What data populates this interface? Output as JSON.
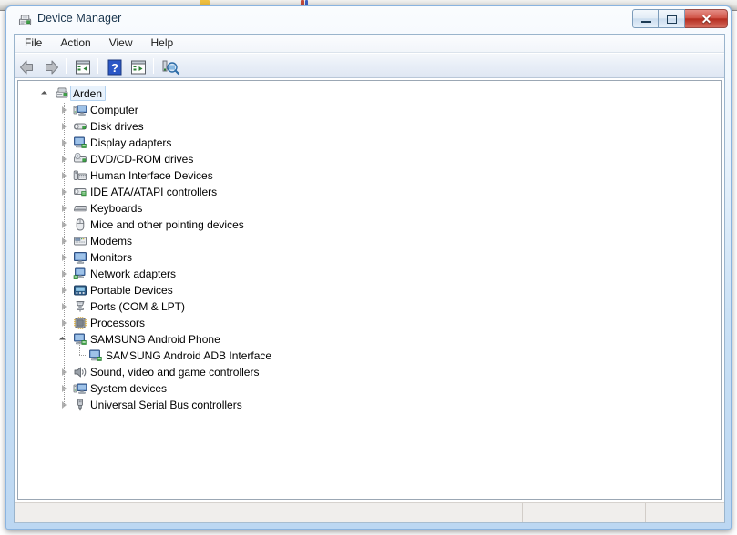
{
  "window": {
    "title": "Device Manager",
    "icon": "device-manager-icon",
    "controls": {
      "minimize": "Minimize",
      "maximize": "Maximize",
      "close": "Close",
      "close_glyph": "✕"
    }
  },
  "menubar": {
    "items": [
      {
        "label": "File",
        "name": "menu-file"
      },
      {
        "label": "Action",
        "name": "menu-action"
      },
      {
        "label": "View",
        "name": "menu-view"
      },
      {
        "label": "Help",
        "name": "menu-help"
      }
    ]
  },
  "toolbar": {
    "items": [
      {
        "name": "back-button",
        "icon": "back-arrow-icon",
        "tooltip": "Back"
      },
      {
        "name": "forward-button",
        "icon": "forward-arrow-icon",
        "tooltip": "Forward"
      },
      {
        "name": "toolbar-separator-1",
        "icon": "separator"
      },
      {
        "name": "properties-button",
        "icon": "properties-icon",
        "tooltip": "Properties"
      },
      {
        "name": "toolbar-separator-2",
        "icon": "separator"
      },
      {
        "name": "help-button",
        "icon": "help-question-icon",
        "tooltip": "Help"
      },
      {
        "name": "scan-hardware-changes-button",
        "icon": "scan-changes-icon",
        "tooltip": "Scan for hardware changes"
      },
      {
        "name": "toolbar-separator-3",
        "icon": "separator"
      },
      {
        "name": "update-driver-button",
        "icon": "update-driver-icon",
        "tooltip": "Update Driver Software"
      }
    ]
  },
  "tree": {
    "root": {
      "label": "Arden",
      "icon": "computer-root-icon",
      "expanded": true,
      "selected": true
    },
    "nodes": [
      {
        "label": "Computer",
        "icon": "computer-icon",
        "expanded": false,
        "level": 1
      },
      {
        "label": "Disk drives",
        "icon": "disk-drive-icon",
        "expanded": false,
        "level": 1
      },
      {
        "label": "Display adapters",
        "icon": "display-adapter-icon",
        "expanded": false,
        "level": 1
      },
      {
        "label": "DVD/CD-ROM drives",
        "icon": "dvd-drive-icon",
        "expanded": false,
        "level": 1
      },
      {
        "label": "Human Interface Devices",
        "icon": "hid-icon",
        "expanded": false,
        "level": 1
      },
      {
        "label": "IDE ATA/ATAPI controllers",
        "icon": "ide-controller-icon",
        "expanded": false,
        "level": 1
      },
      {
        "label": "Keyboards",
        "icon": "keyboard-icon",
        "expanded": false,
        "level": 1
      },
      {
        "label": "Mice and other pointing devices",
        "icon": "mouse-icon",
        "expanded": false,
        "level": 1
      },
      {
        "label": "Modems",
        "icon": "modem-icon",
        "expanded": false,
        "level": 1
      },
      {
        "label": "Monitors",
        "icon": "monitor-icon",
        "expanded": false,
        "level": 1
      },
      {
        "label": "Network adapters",
        "icon": "network-adapter-icon",
        "expanded": false,
        "level": 1
      },
      {
        "label": "Portable Devices",
        "icon": "portable-device-icon",
        "expanded": false,
        "level": 1
      },
      {
        "label": "Ports (COM & LPT)",
        "icon": "port-icon",
        "expanded": false,
        "level": 1
      },
      {
        "label": "Processors",
        "icon": "processor-icon",
        "expanded": false,
        "level": 1
      },
      {
        "label": "SAMSUNG Android Phone",
        "icon": "android-phone-icon",
        "expanded": true,
        "level": 1
      },
      {
        "label": "SAMSUNG Android ADB Interface",
        "icon": "adb-interface-icon",
        "expanded": null,
        "level": 2
      },
      {
        "label": "Sound, video and game controllers",
        "icon": "sound-controller-icon",
        "expanded": false,
        "level": 1
      },
      {
        "label": "System devices",
        "icon": "system-device-icon",
        "expanded": false,
        "level": 1
      },
      {
        "label": "Universal Serial Bus controllers",
        "icon": "usb-controller-icon",
        "expanded": false,
        "level": 1
      }
    ]
  },
  "statusbar": {
    "message": "",
    "panel_2": "",
    "panel_3": ""
  },
  "colors": {
    "frame": "#bcd7f2",
    "titlebar_text": "#17344d",
    "close_button": "#b52d20",
    "selection_fill": "#e8f2fc",
    "selection_border": "#b4d2ef",
    "content_bg": "#ffffff",
    "statusbar_bg": "#f0eeec",
    "toolbar_bg": "#e8eef7"
  }
}
